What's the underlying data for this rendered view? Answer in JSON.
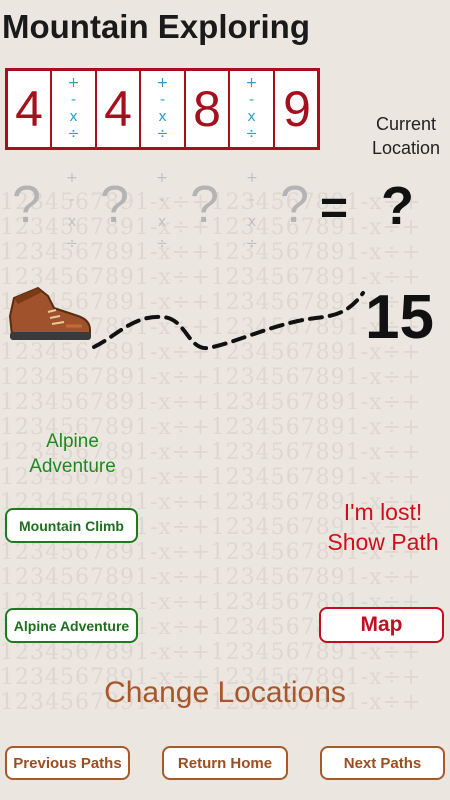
{
  "title": "Mountain Exploring",
  "location": {
    "digits": [
      "4",
      "4",
      "8",
      "9"
    ],
    "operators": [
      "+",
      "-",
      "x",
      "÷"
    ],
    "label_line1": "Current",
    "label_line2": "Location"
  },
  "equation": {
    "unknown": "?",
    "equals": "=",
    "result": "?"
  },
  "steps_remaining": "15",
  "current_path": {
    "line1": "Alpine",
    "line2": "Adventure"
  },
  "paths": [
    "Mountain Climb",
    "Alpine Adventure"
  ],
  "lost_line1": "I'm lost!",
  "lost_line2": "Show Path",
  "map_label": "Map",
  "change_label": "Change Locations",
  "nav": {
    "previous": "Previous Paths",
    "home": "Return Home",
    "next": "Next Paths"
  },
  "colors": {
    "accent_red": "#a6101c",
    "path_green": "#1f7a1f",
    "nav_brown": "#a65a2c",
    "operator_blue": "#2aa0c8"
  }
}
